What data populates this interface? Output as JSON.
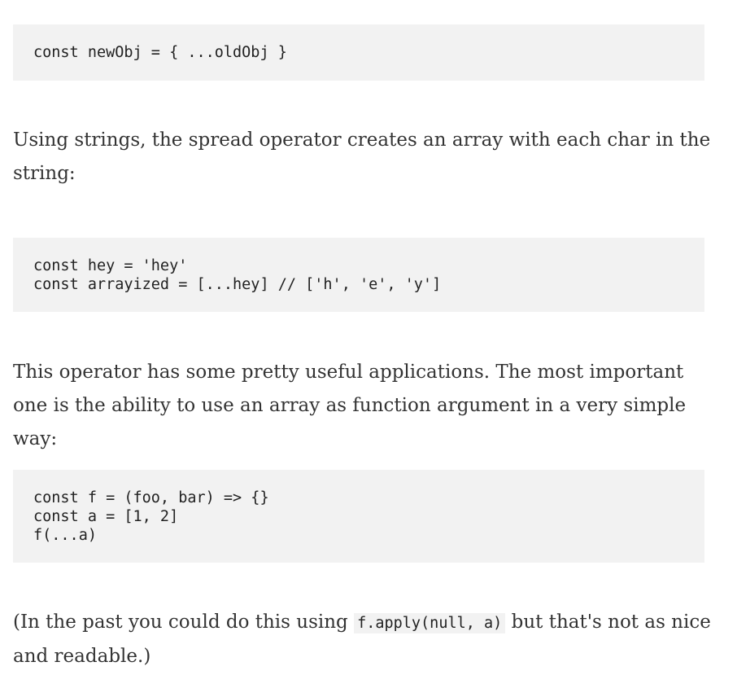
{
  "blocks": {
    "code1": [
      "const newObj = { ...oldObj }"
    ],
    "para1": "Using strings, the spread operator creates an array with each char in the string:",
    "code2": [
      "const hey = 'hey'",
      "const arrayized = [...hey] // ['h', 'e', 'y']"
    ],
    "para2": "This operator has some pretty useful applications. The most important one is the ability to use an array as function argument in a very simple way:",
    "code3": [
      "const f = (foo, bar) => {}",
      "const a = [1, 2]",
      "f(...a)"
    ],
    "para3": {
      "before": "(In the past you could do this using ",
      "code": "f.apply(null, a)",
      "after": " but that's not as nice and readable.)"
    }
  }
}
